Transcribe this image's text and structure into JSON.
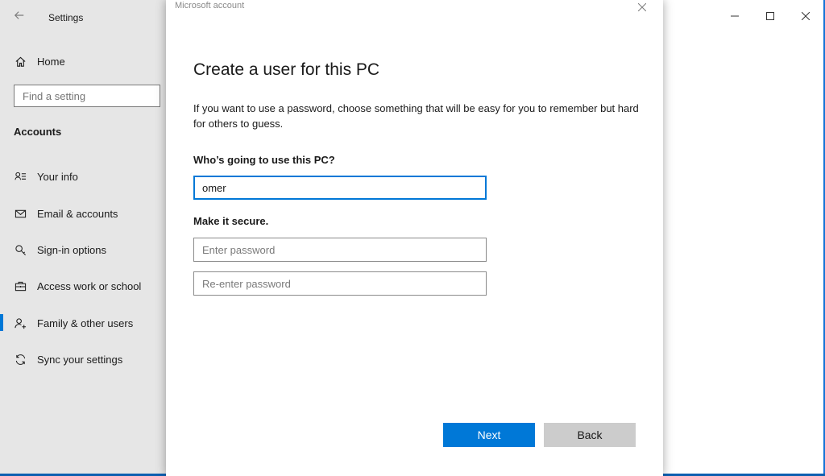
{
  "settings": {
    "title": "Settings",
    "back_icon": "back-arrow-icon",
    "home_label": "Home",
    "search_placeholder": "Find a setting",
    "section_title": "Accounts",
    "nav": [
      {
        "label": "Your info",
        "icon": "person-card-icon"
      },
      {
        "label": "Email & accounts",
        "icon": "mail-icon"
      },
      {
        "label": "Sign-in options",
        "icon": "key-icon"
      },
      {
        "label": "Access work or school",
        "icon": "briefcase-icon"
      },
      {
        "label": "Family & other users",
        "icon": "add-person-icon",
        "selected": true
      },
      {
        "label": "Sync your settings",
        "icon": "sync-icon"
      }
    ],
    "window_controls": {
      "minimize": "—",
      "maximize": "☐",
      "close": "✕"
    }
  },
  "dialog": {
    "caption": "Microsoft account",
    "close_glyph": "✕",
    "heading": "Create a user for this PC",
    "description": "If you want to use a password, choose something that will be easy for you to remember but hard for others to guess.",
    "who_label": "Who’s going to use this PC?",
    "username_value": "omer",
    "secure_label": "Make it secure.",
    "password_placeholder": "Enter password",
    "reenter_placeholder": "Re-enter password",
    "next_label": "Next",
    "back_label": "Back"
  },
  "colors": {
    "accent": "#0078d7",
    "sidebar_bg": "#e6e6e6",
    "desktop": "#0d5fb0"
  }
}
